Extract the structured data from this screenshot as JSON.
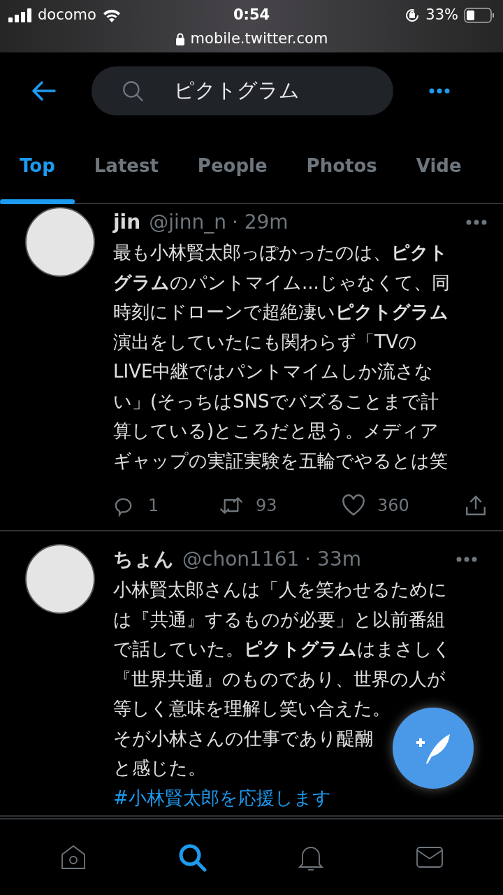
{
  "status_bar": {
    "carrier": "docomo",
    "time": "0:54",
    "battery": "33%",
    "url": "mobile.twitter.com"
  },
  "search": {
    "value": "ピクトグラム"
  },
  "tabs": [
    {
      "label": "Top",
      "selected": true
    },
    {
      "label": "Latest",
      "selected": false
    },
    {
      "label": "People",
      "selected": false
    },
    {
      "label": "Photos",
      "selected": false
    },
    {
      "label": "Vide",
      "selected": false
    }
  ],
  "tweets": [
    {
      "name": "jin",
      "handle": "@jinn_n",
      "time": "· 29m",
      "text_blocks": [
        [
          "最も小林賢太郎っぽかったのは、**ピクト**",
          "**グラム**のパントマイム...じゃなくて、同",
          "時刻にドローンで超絶凄い**ピクトグラム**",
          "演出をしていたにも関わらず「TVの",
          "LIVE中継ではパントマイムしか流さな",
          "い」(そっちはSNSでバズることまで計",
          "算している)ところだと思う。メディア",
          "ギャップの実証実験を五輪でやるとは笑"
        ]
      ],
      "replies": "1",
      "retweets": "93",
      "likes": "360"
    },
    {
      "name": "ちょん",
      "handle": "@chon1161",
      "time": "· 33m",
      "text_blocks": [
        [
          "小林賢太郎さんは「人を笑わせるために",
          "は『共通』するものが必要」と以前番組",
          "で話していた。**ピクトグラム**はまさしく",
          "『世界共通』のものであり、世界の人が"
        ],
        [
          "等しく意味を理解し笑い合えた。",
          "そが小林さんの仕事であり醍醐",
          "と感じた。"
        ]
      ],
      "hashtag": "#小林賢太郎を応援します"
    }
  ],
  "nav": [
    {
      "kind": "home",
      "selected": false
    },
    {
      "kind": "search",
      "selected": true
    },
    {
      "kind": "bell",
      "selected": false
    },
    {
      "kind": "mail",
      "selected": false
    }
  ]
}
